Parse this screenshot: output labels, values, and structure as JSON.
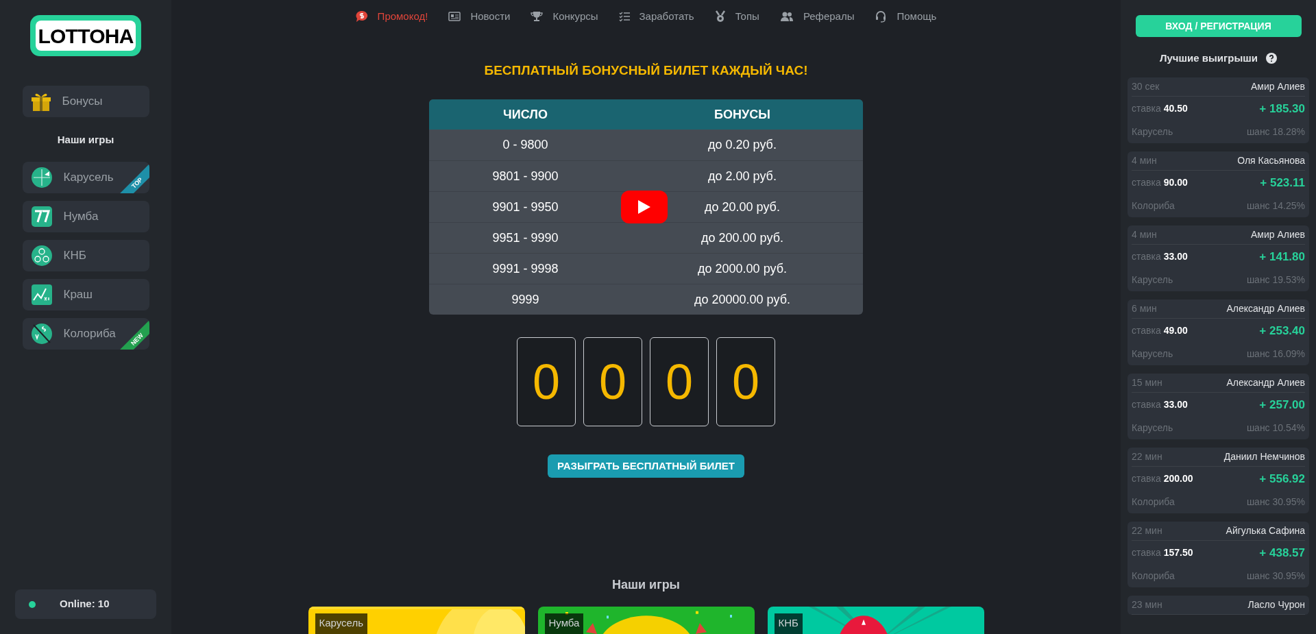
{
  "logo": "LOTTOHA",
  "sidebar": {
    "bonus": {
      "label": "Бонусы"
    },
    "games_title": "Наши игры",
    "games": [
      {
        "label": "Карусель",
        "kind": "carousel",
        "ribbon": {
          "text": "TOP",
          "color": "#1e8fa8"
        }
      },
      {
        "label": "Нумба",
        "kind": "numba"
      },
      {
        "label": "КНБ",
        "kind": "knb"
      },
      {
        "label": "Краш",
        "kind": "crash"
      },
      {
        "label": "Колориба",
        "kind": "coloriba",
        "ribbon": {
          "text": "NEW",
          "color": "#23a04f"
        }
      }
    ],
    "online": {
      "text": "Online: 10",
      "color": "#27d29a"
    }
  },
  "nav": [
    {
      "label": "Промокод!",
      "kind": "promo"
    },
    {
      "label": "Новости",
      "kind": "news"
    },
    {
      "label": "Конкурсы",
      "kind": "trophy"
    },
    {
      "label": "Заработать",
      "kind": "list"
    },
    {
      "label": "Топы",
      "kind": "medal"
    },
    {
      "label": "Рефералы",
      "kind": "users"
    },
    {
      "label": "Помощь",
      "kind": "help"
    }
  ],
  "headline": "БЕСПЛАТНЫЙ БОНУСНЫЙ БИЛЕТ КАЖДЫЙ ЧАС!",
  "table": {
    "columns": [
      "ЧИСЛО",
      "БОНУСЫ"
    ],
    "rows": [
      [
        "0 - 9800",
        "до 0.20 руб."
      ],
      [
        "9801 - 9900",
        "до 2.00 руб."
      ],
      [
        "9901 - 9950",
        "до 20.00 руб."
      ],
      [
        "9951 - 9990",
        "до 200.00 руб."
      ],
      [
        "9991 - 9998",
        "до 2000.00 руб."
      ],
      [
        "9999",
        "до 20000.00 руб."
      ]
    ]
  },
  "digits": [
    "0",
    "0",
    "0",
    "0"
  ],
  "play_button": "РАЗЫГРАТЬ БЕСПЛАТНЫЙ БИЛЕТ",
  "games_section": {
    "title": "Наши игры",
    "cards": [
      {
        "label": "Карусель",
        "kind": "carousel"
      },
      {
        "label": "Нумба",
        "kind": "numba"
      },
      {
        "label": "КНБ",
        "kind": "knb"
      }
    ]
  },
  "right": {
    "login_button": "ВХОД / РЕГИСТРАЦИЯ",
    "title": "Лучшие выигрыши",
    "wins": [
      {
        "time": "30 сек",
        "name": "Амир Алиев",
        "stake_label": "ставка",
        "stake": "40.50",
        "win": "+ 185.30",
        "game": "Карусель",
        "chance": "шанс 18.28%"
      },
      {
        "time": "4 мин",
        "name": "Оля Касьянова",
        "stake_label": "ставка",
        "stake": "90.00",
        "win": "+ 523.11",
        "game": "Колориба",
        "chance": "шанс 14.25%"
      },
      {
        "time": "4 мин",
        "name": "Амир Алиев",
        "stake_label": "ставка",
        "stake": "33.00",
        "win": "+ 141.80",
        "game": "Карусель",
        "chance": "шанс 19.53%"
      },
      {
        "time": "6 мин",
        "name": "Александр Алиев",
        "stake_label": "ставка",
        "stake": "49.00",
        "win": "+ 253.40",
        "game": "Карусель",
        "chance": "шанс 16.09%"
      },
      {
        "time": "15 мин",
        "name": "Александр Алиев",
        "stake_label": "ставка",
        "stake": "33.00",
        "win": "+ 257.00",
        "game": "Карусель",
        "chance": "шанс 10.54%"
      },
      {
        "time": "22 мин",
        "name": "Даниил Немчинов",
        "stake_label": "ставка",
        "stake": "200.00",
        "win": "+ 556.92",
        "game": "Колориба",
        "chance": "шанс 30.95%"
      },
      {
        "time": "22 мин",
        "name": "Айгулька Сафина",
        "stake_label": "ставка",
        "stake": "157.50",
        "win": "+ 438.57",
        "game": "Колориба",
        "chance": "шанс 30.95%"
      },
      {
        "time": "23 мин",
        "name": "Ласло Чурон"
      }
    ]
  }
}
